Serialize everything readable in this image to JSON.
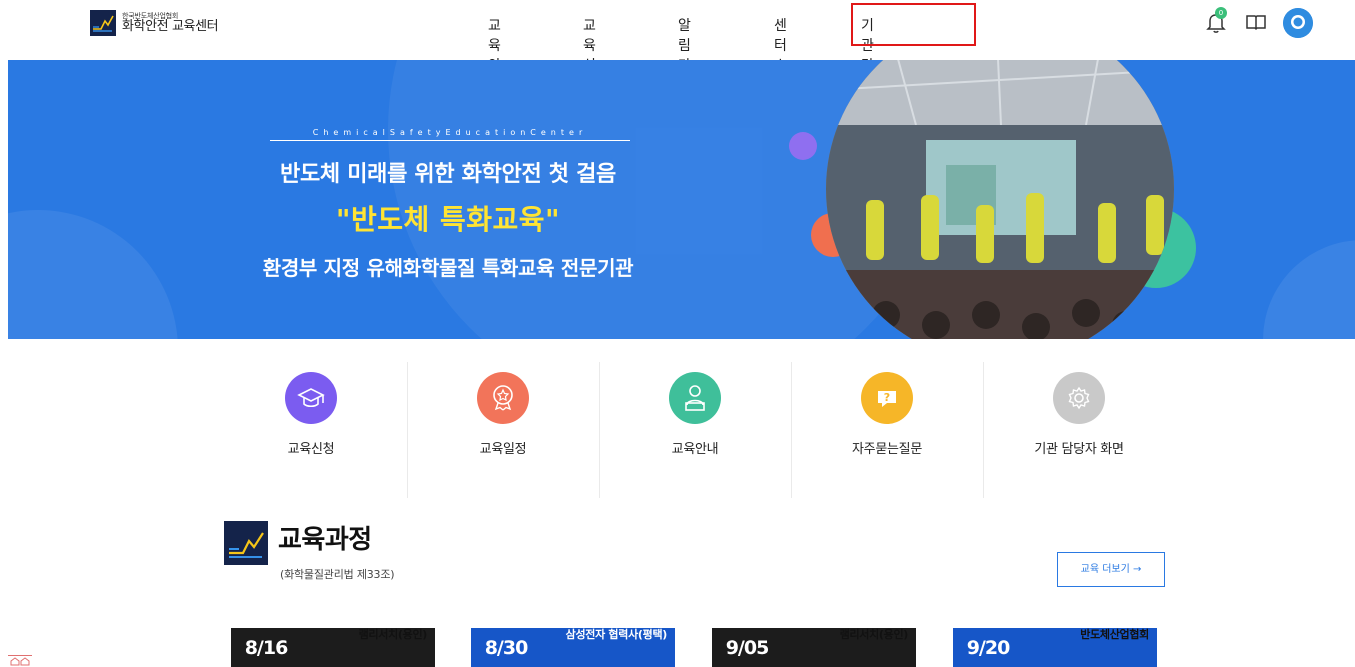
{
  "logo": {
    "sub": "한국반도체산업협회",
    "main": "화학안전 교육센터"
  },
  "nav": {
    "items": [
      "교육안내",
      "교육신청",
      "알림마당",
      "센터소개",
      "기관 담당자 화면"
    ]
  },
  "header_icons": {
    "bell_badge": "0",
    "bell": "bell-icon",
    "book": "book-icon",
    "avatar": "avatar-icon"
  },
  "hero": {
    "tagline": "ChemicalSafetyEducationCenter",
    "line1": "반도체 미래를 위한 화학안전 첫 걸음",
    "line2": "\"반도체 특화교육\"",
    "line3": "환경부 지정 유해화학물질 특화교육 전문기관"
  },
  "quick_links": [
    {
      "label": "교육신청",
      "icon": "graduation-cap-icon",
      "color": "#7b5cf0"
    },
    {
      "label": "교육일정",
      "icon": "award-icon",
      "color": "#f2745a"
    },
    {
      "label": "교육안내",
      "icon": "instructor-icon",
      "color": "#3fbf9a"
    },
    {
      "label": "자주묻는질문",
      "icon": "question-icon",
      "color": "#f6b628"
    },
    {
      "label": "기관 담당자 화면",
      "icon": "gear-icon",
      "color": "#c9c9c9"
    }
  ],
  "education": {
    "title": "교육과정",
    "subtitle": "(화학물질관리법 제33조)",
    "more_button": "교육 더보기 →",
    "cards": [
      {
        "date": "8/16",
        "title": "램리서치(용인)",
        "date_bg": "#1c1c1c",
        "body_bg": "#1c1c1c"
      },
      {
        "date": "8/30",
        "title": "삼성전자 협력사(평택)",
        "date_bg": "#1656c8",
        "body_bg": "#1656c8"
      },
      {
        "date": "9/05",
        "title": "램리서치(용인)",
        "date_bg": "#1c1c1c",
        "body_bg": "#1c1c1c"
      },
      {
        "date": "9/20",
        "title": "반도체산업협회",
        "date_bg": "#1656c8",
        "body_bg": "#1656c8"
      }
    ]
  },
  "colors": {
    "hero_bg": "#2a79e2",
    "highlight": "#e01818",
    "accent_yellow": "#ffe433"
  }
}
